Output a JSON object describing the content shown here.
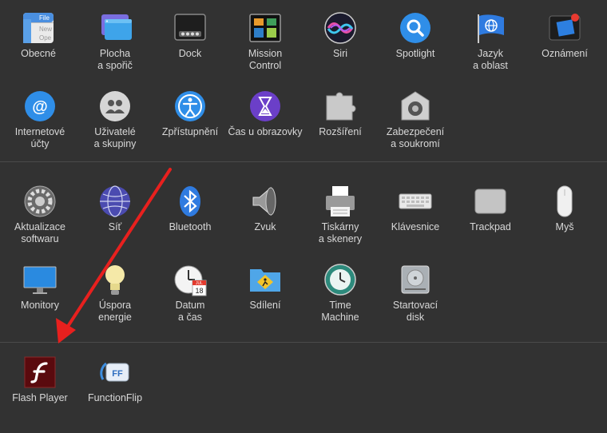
{
  "panes": {
    "obecne": {
      "label": "Obecné",
      "icon": "general-icon",
      "icon_text_top": "File",
      "icon_text_mid": "New",
      "icon_text_bot": "Ope"
    },
    "plocha": {
      "label": "Plocha\na spořič",
      "icon": "desktop-screensaver-icon"
    },
    "dock": {
      "label": "Dock",
      "icon": "dock-icon"
    },
    "mission": {
      "label": "Mission\nControl",
      "icon": "mission-control-icon"
    },
    "siri": {
      "label": "Siri",
      "icon": "siri-icon"
    },
    "spotlight": {
      "label": "Spotlight",
      "icon": "spotlight-icon"
    },
    "jazyk": {
      "label": "Jazyk\na oblast",
      "icon": "language-region-icon"
    },
    "oznameni": {
      "label": "Oznámení",
      "icon": "notifications-icon"
    },
    "internetove": {
      "label": "Internetové\núčty",
      "icon": "internet-accounts-icon"
    },
    "uzivatele": {
      "label": "Uživatelé\na skupiny",
      "icon": "users-groups-icon"
    },
    "zpristupneni": {
      "label": "Zpřístupnění",
      "icon": "accessibility-icon"
    },
    "cas": {
      "label": "Čas u obrazovky",
      "icon": "screen-time-icon"
    },
    "rozsireni": {
      "label": "Rozšíření",
      "icon": "extensions-icon"
    },
    "zabezpeceni": {
      "label": "Zabezpečení\na soukromí",
      "icon": "security-privacy-icon"
    },
    "aktualizace": {
      "label": "Aktualizace\nsoftwaru",
      "icon": "software-update-icon"
    },
    "sit": {
      "label": "Síť",
      "icon": "network-icon"
    },
    "bluetooth": {
      "label": "Bluetooth",
      "icon": "bluetooth-icon"
    },
    "zvuk": {
      "label": "Zvuk",
      "icon": "sound-icon"
    },
    "tiskarny": {
      "label": "Tiskárny\na skenery",
      "icon": "printers-scanners-icon"
    },
    "klavesnice": {
      "label": "Klávesnice",
      "icon": "keyboard-icon"
    },
    "trackpad": {
      "label": "Trackpad",
      "icon": "trackpad-icon"
    },
    "mys": {
      "label": "Myš",
      "icon": "mouse-icon"
    },
    "monitory": {
      "label": "Monitory",
      "icon": "displays-icon"
    },
    "uspora": {
      "label": "Úspora\nenergie",
      "icon": "energy-saver-icon"
    },
    "datum": {
      "label": "Datum\na čas",
      "icon": "date-time-icon",
      "icon_month": "JUL",
      "icon_day": "18"
    },
    "sdileni": {
      "label": "Sdílení",
      "icon": "sharing-icon"
    },
    "time": {
      "label": "Time\nMachine",
      "icon": "time-machine-icon"
    },
    "startovaci": {
      "label": "Startovací\ndisk",
      "icon": "startup-disk-icon"
    },
    "flash": {
      "label": "Flash Player",
      "icon": "flash-player-icon"
    },
    "functionflip": {
      "label": "FunctionFlip",
      "icon": "functionflip-icon",
      "icon_text": "FF"
    }
  },
  "colors": {
    "background": "#323232",
    "label": "#d8d8d8",
    "arrow": "#e8201e"
  }
}
